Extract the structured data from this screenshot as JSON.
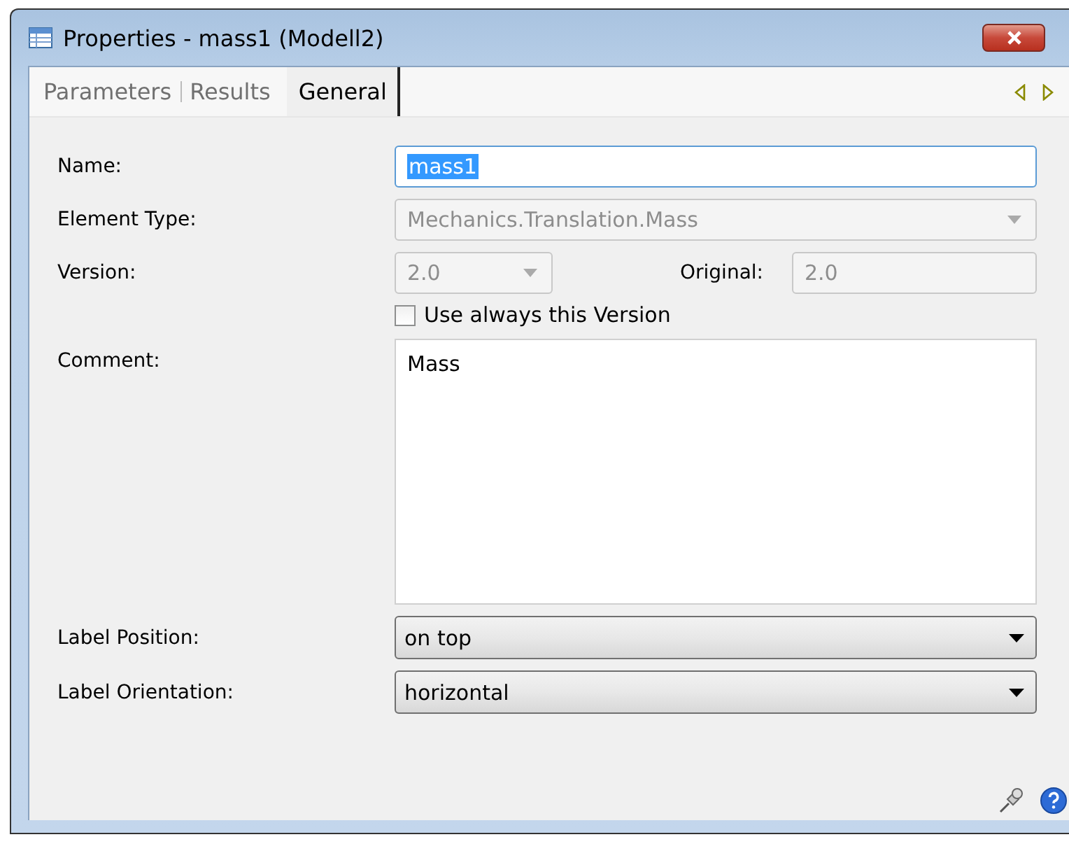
{
  "window": {
    "title": "Properties - mass1 (Modell2)"
  },
  "tabs": [
    {
      "label": "Parameters",
      "selected": false
    },
    {
      "label": "Results",
      "selected": false
    },
    {
      "label": "General",
      "selected": true
    }
  ],
  "form": {
    "name": {
      "label": "Name:",
      "value": "mass1",
      "highlighted": true
    },
    "element_type": {
      "label": "Element Type:",
      "value": "Mechanics.Translation.Mass",
      "disabled": true
    },
    "version": {
      "label": "Version:",
      "value": "2.0",
      "disabled": true
    },
    "original": {
      "label": "Original:",
      "value": "2.0",
      "disabled": true
    },
    "use_always": {
      "label": "Use always this Version",
      "checked": false
    },
    "comment": {
      "label": "Comment:",
      "value": "Mass"
    },
    "label_position": {
      "label": "Label Position:",
      "value": "on top"
    },
    "label_orientation": {
      "label": "Label Orientation:",
      "value": "horizontal"
    }
  }
}
